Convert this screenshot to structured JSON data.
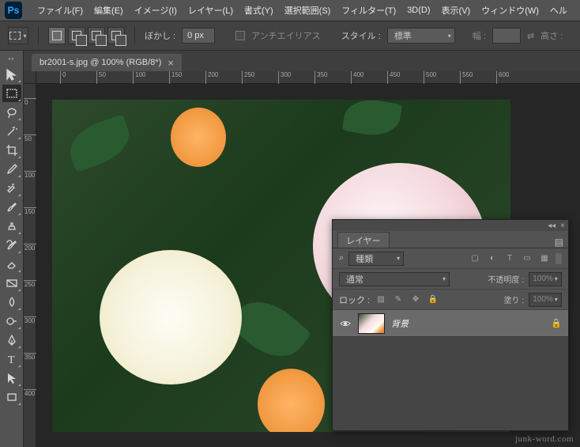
{
  "app": {
    "logo_text": "Ps"
  },
  "menubar": {
    "items": [
      "ファイル(F)",
      "編集(E)",
      "イメージ(I)",
      "レイヤー(L)",
      "書式(Y)",
      "選択範囲(S)",
      "フィルター(T)",
      "3D(D)",
      "表示(V)",
      "ウィンドウ(W)",
      "ヘル"
    ]
  },
  "optionsbar": {
    "feather_label": "ぼかし :",
    "feather_value": "0 px",
    "antialias_label": "アンチエイリアス",
    "style_label": "スタイル :",
    "style_value": "標準",
    "width_label": "幅 :",
    "height_label": "高さ :"
  },
  "document": {
    "tab_title": "br2001-s.jpg @ 100% (RGB/8*)",
    "ruler_marks_h": [
      "0",
      "50",
      "100",
      "150",
      "200",
      "250",
      "300",
      "350",
      "400",
      "450",
      "500",
      "550",
      "600"
    ],
    "ruler_marks_v": [
      "0",
      "50",
      "100",
      "150",
      "200",
      "250",
      "300",
      "350",
      "400"
    ]
  },
  "layers_panel": {
    "tab_label": "レイヤー",
    "filter_label": "種類",
    "blend_mode": "通常",
    "opacity_label": "不透明度 :",
    "opacity_value": "100%",
    "lock_label": "ロック :",
    "fill_label": "塗り :",
    "fill_value": "100%",
    "layer_name": "背景",
    "search_icon": "⌕"
  },
  "watermark": "junk-word.com"
}
